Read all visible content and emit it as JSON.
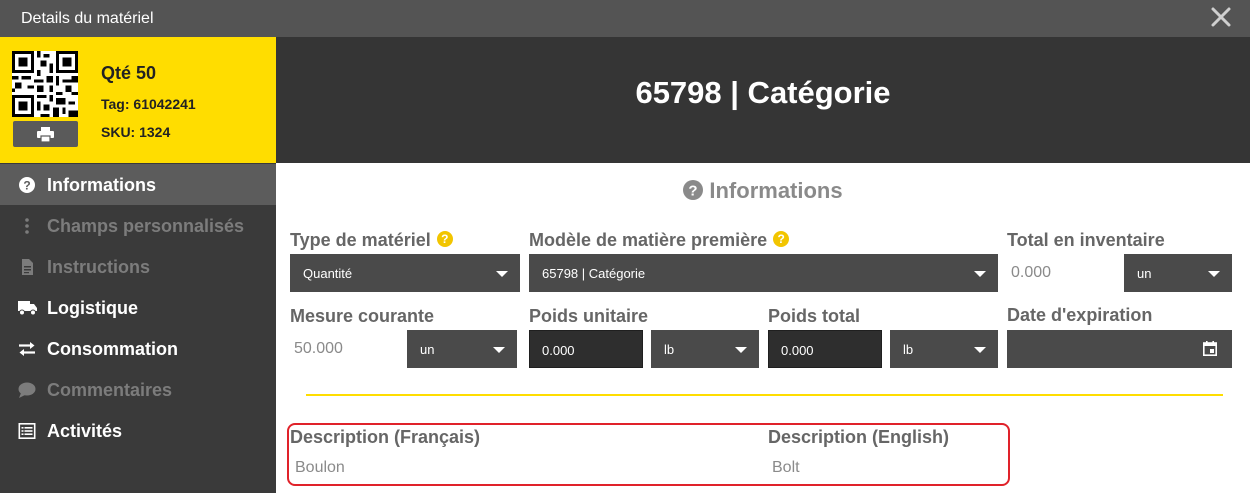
{
  "window": {
    "title": "Details du matériel"
  },
  "summary": {
    "qty": "Qté 50",
    "tag": "Tag: 61042241",
    "sku": "SKU: 1324"
  },
  "menu": [
    {
      "label": "Informations",
      "icon": "question-circle-icon",
      "active": true,
      "enabled": true
    },
    {
      "label": "Champs personnalisés",
      "icon": "vertical-dots-icon",
      "active": false,
      "enabled": false
    },
    {
      "label": "Instructions",
      "icon": "document-icon",
      "active": false,
      "enabled": false
    },
    {
      "label": "Logistique",
      "icon": "truck-icon",
      "active": false,
      "enabled": true
    },
    {
      "label": "Consommation",
      "icon": "exchange-arrows-icon",
      "active": false,
      "enabled": true
    },
    {
      "label": "Commentaires",
      "icon": "comment-icon",
      "active": false,
      "enabled": false
    },
    {
      "label": "Activités",
      "icon": "list-icon",
      "active": false,
      "enabled": true
    }
  ],
  "header": {
    "title": "65798 | Catégorie"
  },
  "section": {
    "title": "Informations"
  },
  "fields": {
    "type_materiel": {
      "label": "Type de matériel",
      "value": "Quantité"
    },
    "modele_matiere": {
      "label": "Modèle de matière première",
      "value": "65798 | Catégorie"
    },
    "total_inventaire": {
      "label": "Total en inventaire",
      "value": "0.000",
      "unit": "un"
    },
    "mesure_courante": {
      "label": "Mesure courante",
      "value": "50.000",
      "unit": "un"
    },
    "poids_unitaire": {
      "label": "Poids unitaire",
      "value": "0.000",
      "unit": "lb"
    },
    "poids_total": {
      "label": "Poids total",
      "value": "0.000",
      "unit": "lb"
    },
    "date_expiration": {
      "label": "Date d'expiration",
      "value": ""
    }
  },
  "descriptions": {
    "fr": {
      "label": "Description (Français)",
      "value": "Boulon"
    },
    "en": {
      "label": "Description (English)",
      "value": "Bolt"
    }
  },
  "colors": {
    "accent": "#ffdd00",
    "sidebar": "#3a3a3a",
    "header": "#353535",
    "titlebar": "#545454",
    "highlight_border": "#e0222a"
  }
}
